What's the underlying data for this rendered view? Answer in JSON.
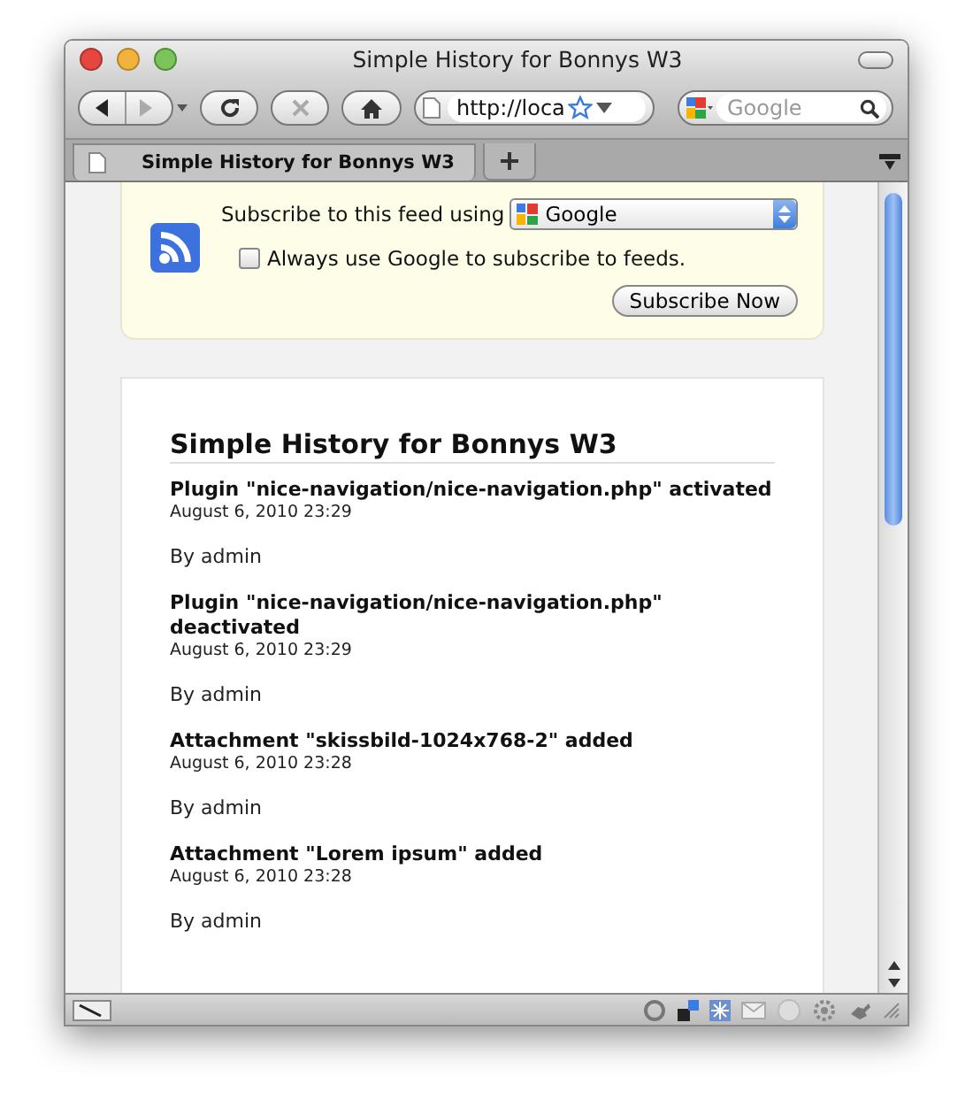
{
  "window": {
    "title": "Simple History for Bonnys W3"
  },
  "toolbar": {
    "address": "http://loca",
    "search_placeholder": "Google"
  },
  "tabs": [
    {
      "label": "Simple History for Bonnys W3",
      "selected": true
    }
  ],
  "feed_box": {
    "prompt": "Subscribe to this feed using",
    "reader": "Google",
    "always_use": {
      "label": "Always use Google to subscribe to feeds.",
      "checked": false
    },
    "button": "Subscribe Now"
  },
  "history": {
    "heading": "Simple History for Bonnys W3",
    "entries": [
      {
        "title": "Plugin \"nice-navigation/nice-navigation.php\" activated",
        "date": "August 6, 2010 23:29",
        "user": "By admin"
      },
      {
        "title": "Plugin \"nice-navigation/nice-navigation.php\" deactivated",
        "date": "August 6, 2010 23:29",
        "user": "By admin"
      },
      {
        "title": "Attachment \"skissbild-1024x768-2\" added",
        "date": "August 6, 2010 23:28",
        "user": "By admin"
      },
      {
        "title": "Attachment \"Lorem ipsum\" added",
        "date": "August 6, 2010 23:28",
        "user": "By admin"
      }
    ]
  }
}
